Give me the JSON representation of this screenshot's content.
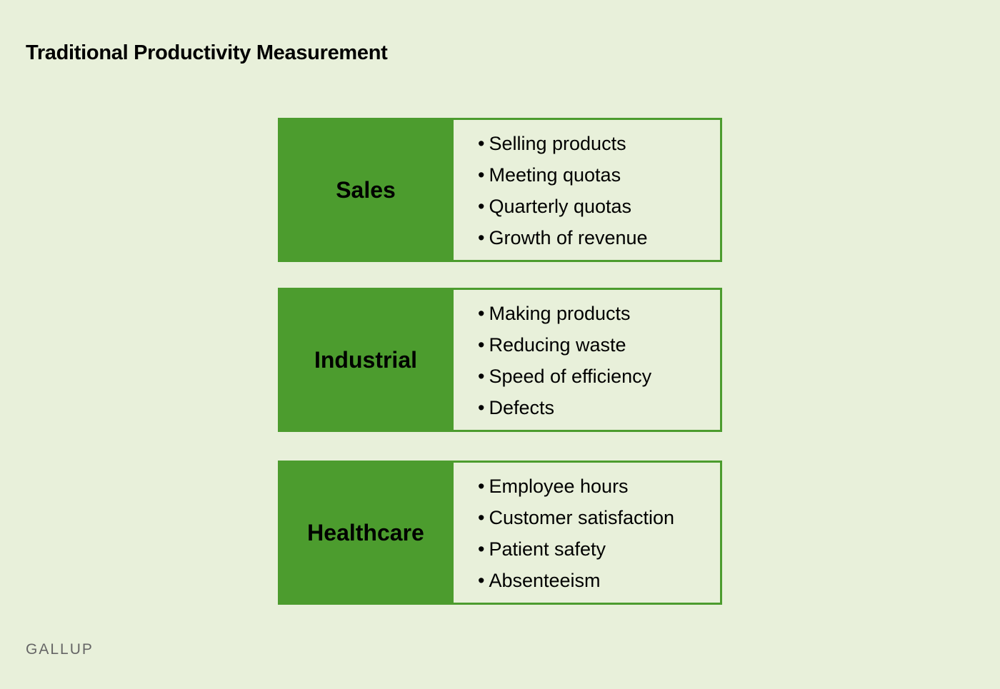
{
  "title": "Traditional Productivity Measurement",
  "colors": {
    "accent": "#4c9c2e",
    "background": "#e8f0da"
  },
  "categories": [
    {
      "label": "Sales",
      "items": [
        "Selling products",
        "Meeting quotas",
        "Quarterly quotas",
        "Growth of revenue"
      ]
    },
    {
      "label": "Industrial",
      "items": [
        "Making products",
        "Reducing waste",
        "Speed of efficiency",
        "Defects"
      ]
    },
    {
      "label": "Healthcare",
      "items": [
        "Employee hours",
        "Customer satisfaction",
        "Patient safety",
        "Absenteeism"
      ]
    }
  ],
  "bullet": "•",
  "footer": "GALLUP"
}
